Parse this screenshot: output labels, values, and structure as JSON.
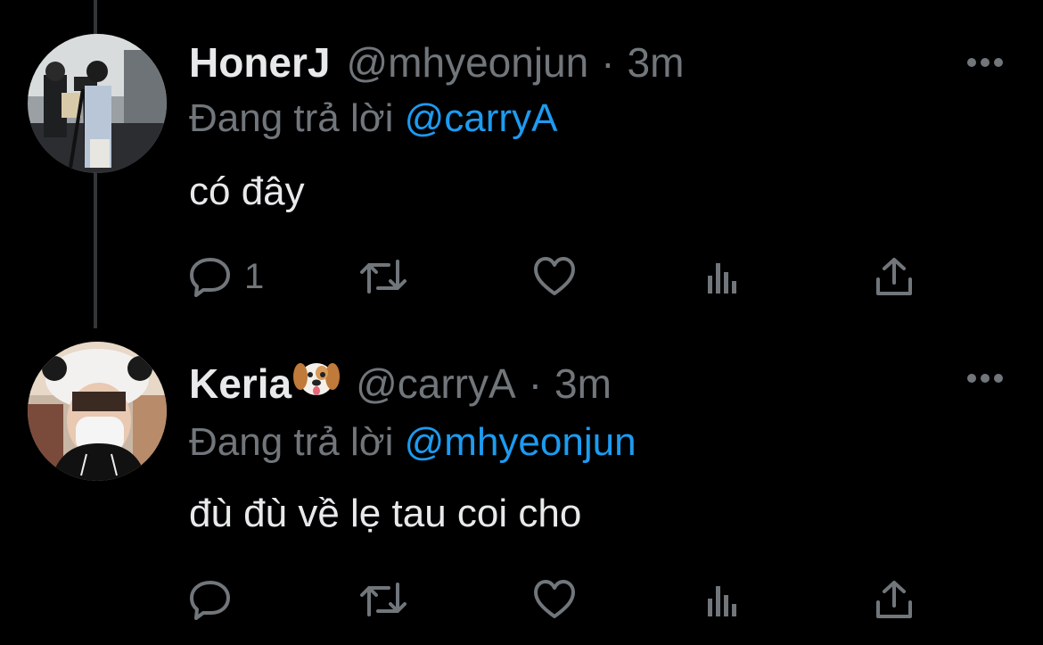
{
  "tweets": [
    {
      "display_name": "HonerJ",
      "handle": "@mhyeonjun",
      "separator": "·",
      "time": "3m",
      "reply_prefix": "Đang trả lời",
      "reply_to": "@carryA",
      "text": "có đây",
      "reply_count": "1",
      "avatar_icon": "user-photo-camera-tripod",
      "colors": {
        "accent": "#1d9bf0",
        "muted": "#71767b"
      }
    },
    {
      "display_name": "Keria",
      "name_emoji": "dog-face-emoji",
      "handle": "@carryA",
      "separator": "·",
      "time": "3m",
      "reply_prefix": "Đang trả lời",
      "reply_to": "@mhyeonjun",
      "text": "đù đù về lẹ tau coi cho",
      "reply_count": "",
      "avatar_icon": "user-photo-mask-hat",
      "colors": {
        "accent": "#1d9bf0",
        "muted": "#71767b"
      }
    }
  ],
  "action_icons": [
    "reply-icon",
    "retweet-icon",
    "like-icon",
    "views-icon",
    "share-icon"
  ]
}
